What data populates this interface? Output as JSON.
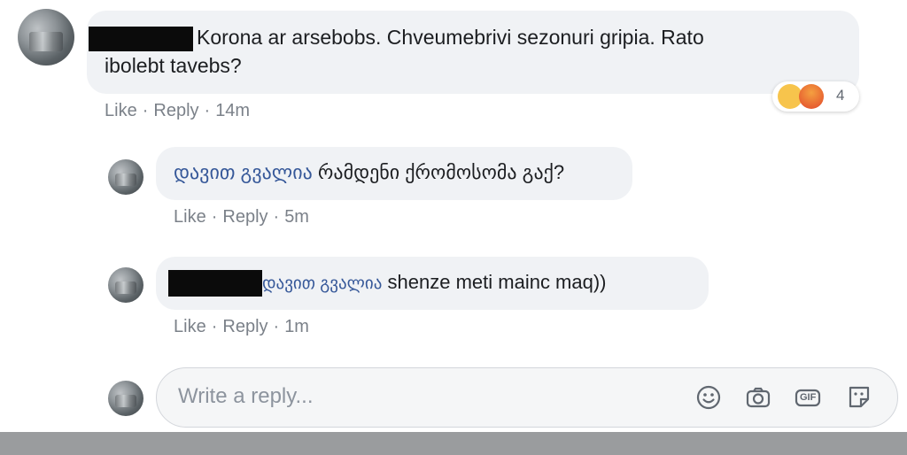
{
  "comment": {
    "text": "Korona ar arsebobs. Chveumebrivi sezonuri gripia. Rato ibolebt tavebs?",
    "line1": "Korona ar arsebobs. Chveumebrivi sezonuri gripia. Rato",
    "line2": "ibolebt tavebs?",
    "actions": {
      "like": "Like",
      "reply": "Reply",
      "time": "14m"
    },
    "reactions": {
      "count": "4",
      "types": [
        "sad-icon",
        "angry-icon"
      ]
    }
  },
  "reply1": {
    "author": "დავით გვალია",
    "text": "რამდენი ქრომოსომა გაქ?",
    "actions": {
      "like": "Like",
      "reply": "Reply",
      "time": "5m"
    }
  },
  "reply2": {
    "mention": "დავით გვალია",
    "text": "shenze meti mainc maq))",
    "actions": {
      "like": "Like",
      "reply": "Reply",
      "time": "1m"
    }
  },
  "composer": {
    "placeholder": "Write a reply...",
    "icons": [
      "smiley-icon",
      "camera-icon",
      "gif-icon",
      "sticker-icon"
    ],
    "gif_label": "GIF"
  },
  "separator": "·"
}
